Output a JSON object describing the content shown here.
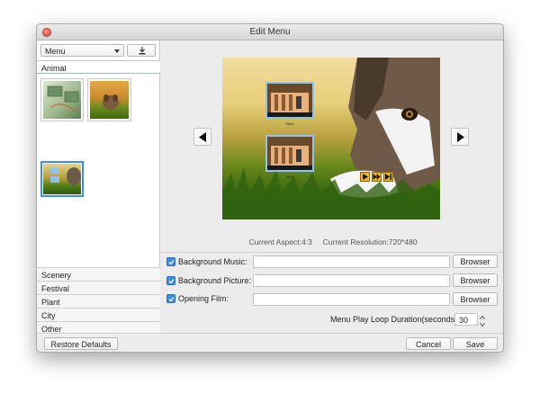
{
  "window": {
    "title": "Edit Menu"
  },
  "sidebar": {
    "menu_select_value": "Menu",
    "download_icon": "download-icon",
    "active_category": "Animal",
    "categories": [
      "Scenery",
      "Festival",
      "Plant",
      "City",
      "Other"
    ]
  },
  "preview": {
    "prev_icon": "triangle-left-icon",
    "next_icon": "triangle-right-icon",
    "caption_1": "Title1",
    "caption_2": "Title2"
  },
  "info": {
    "aspect": "Current Aspect:4:3",
    "resolution": "Current Resolution:720*480"
  },
  "options": [
    {
      "label": "Background Music:",
      "checked": true,
      "value": "",
      "browse_label": "Browser"
    },
    {
      "label": "Background Picture:",
      "checked": true,
      "value": "",
      "browse_label": "Browser"
    },
    {
      "label": "Opening Film:",
      "checked": true,
      "value": "",
      "browse_label": "Browser"
    }
  ],
  "loop": {
    "label": "Menu Play Loop Duration(seconds):",
    "value": "30"
  },
  "footer": {
    "restore_label": "Restore Defaults",
    "cancel_label": "Cancel",
    "save_label": "Save"
  },
  "colors": {
    "accent": "#3b8de8",
    "selection_border": "#8fc4f1",
    "play_controls": "#f0b71a"
  }
}
